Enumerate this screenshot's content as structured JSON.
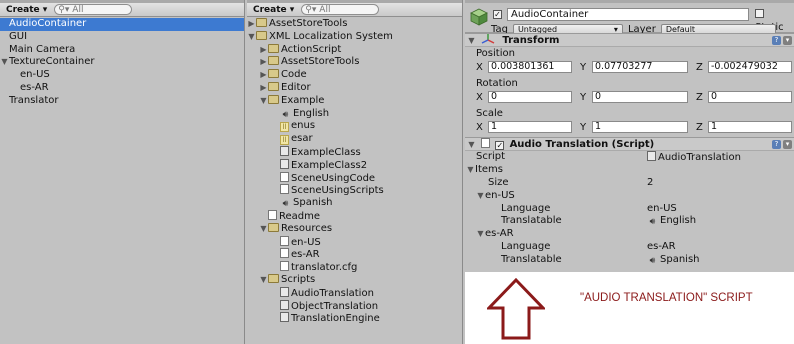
{
  "hierarchy": {
    "create_label": "Create",
    "search_placeholder": "All",
    "items": [
      {
        "label": "AudioContainer",
        "selected": true
      },
      {
        "label": "GUI"
      },
      {
        "label": "Main Camera"
      },
      {
        "label": "TextureContainer",
        "expanded": true
      },
      {
        "label": "en-US"
      },
      {
        "label": "es-AR"
      },
      {
        "label": "Translator"
      }
    ]
  },
  "project": {
    "create_label": "Create",
    "search_placeholder": "All",
    "items": [
      {
        "label": "AssetStoreTools"
      },
      {
        "label": "XML Localization System"
      },
      {
        "label": "ActionScript"
      },
      {
        "label": "AssetStoreTools"
      },
      {
        "label": "Code"
      },
      {
        "label": "Editor"
      },
      {
        "label": "Example"
      },
      {
        "label": "English"
      },
      {
        "label": "enus"
      },
      {
        "label": "esar"
      },
      {
        "label": "ExampleClass"
      },
      {
        "label": "ExampleClass2"
      },
      {
        "label": "SceneUsingCode"
      },
      {
        "label": "SceneUsingScripts"
      },
      {
        "label": "Spanish"
      },
      {
        "label": "Readme"
      },
      {
        "label": "Resources"
      },
      {
        "label": "en-US"
      },
      {
        "label": "es-AR"
      },
      {
        "label": "translator.cfg"
      },
      {
        "label": "Scripts"
      },
      {
        "label": "AudioTranslation"
      },
      {
        "label": "ObjectTranslation"
      },
      {
        "label": "TranslationEngine"
      }
    ]
  },
  "inspector": {
    "object_name": "AudioContainer",
    "static_label": "Static",
    "tag_label": "Tag",
    "tag_value": "Untagged",
    "layer_label": "Layer",
    "layer_value": "Default",
    "transform": {
      "title": "Transform",
      "position_label": "Position",
      "rotation_label": "Rotation",
      "scale_label": "Scale",
      "axes": [
        "X",
        "Y",
        "Z"
      ],
      "position": [
        "0.003801361",
        "0.07703277",
        "-0.002479032"
      ],
      "rotation": [
        "0",
        "0",
        "0"
      ],
      "scale": [
        "1",
        "1",
        "1"
      ]
    },
    "audio_translation": {
      "title": "Audio Translation (Script)",
      "script_label": "Script",
      "script_value": "AudioTranslation",
      "items_label": "Items",
      "size_label": "Size",
      "size_value": "2",
      "entries": [
        {
          "name": "en-US",
          "language_label": "Language",
          "language_value": "en-US",
          "translatable_label": "Translatable",
          "translatable_value": "English"
        },
        {
          "name": "es-AR",
          "language_label": "Language",
          "language_value": "es-AR",
          "translatable_label": "Translatable",
          "translatable_value": "Spanish"
        }
      ]
    },
    "annotation": "\"AUDIO TRANSLATION\" SCRIPT"
  },
  "colors": {
    "selection": "#3d7ad1",
    "annotation": "#8b1a1a",
    "panel_bg": "#c2c2c2"
  }
}
